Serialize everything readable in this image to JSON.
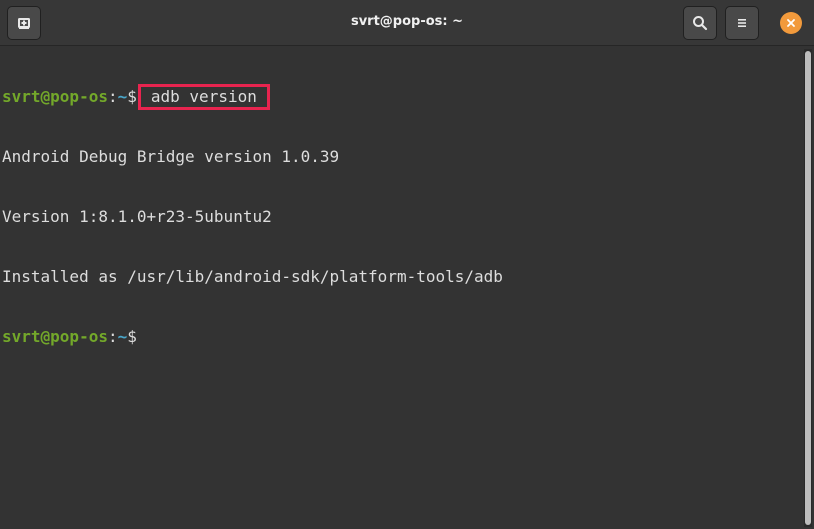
{
  "window": {
    "title": "svrt@pop-os: ~"
  },
  "toolbar": {
    "new_tab_icon": "new-tab-icon",
    "search_icon": "search-icon",
    "menu_icon": "hamburger-menu-icon",
    "close_icon": "close-icon"
  },
  "terminal": {
    "prompt": {
      "user_host": "svrt@pop-os",
      "separator": ":",
      "path": "~",
      "symbol": "$"
    },
    "command": "adb version",
    "output": [
      "Android Debug Bridge version 1.0.39",
      "Version 1:8.1.0+r23-5ubuntu2",
      "Installed as /usr/lib/android-sdk/platform-tools/adb"
    ]
  },
  "colors": {
    "background": "#333333",
    "prompt_user": "#73a82a",
    "prompt_path": "#4aa6c9",
    "highlight_box": "#e8244f",
    "close_button": "#f29a3c"
  }
}
